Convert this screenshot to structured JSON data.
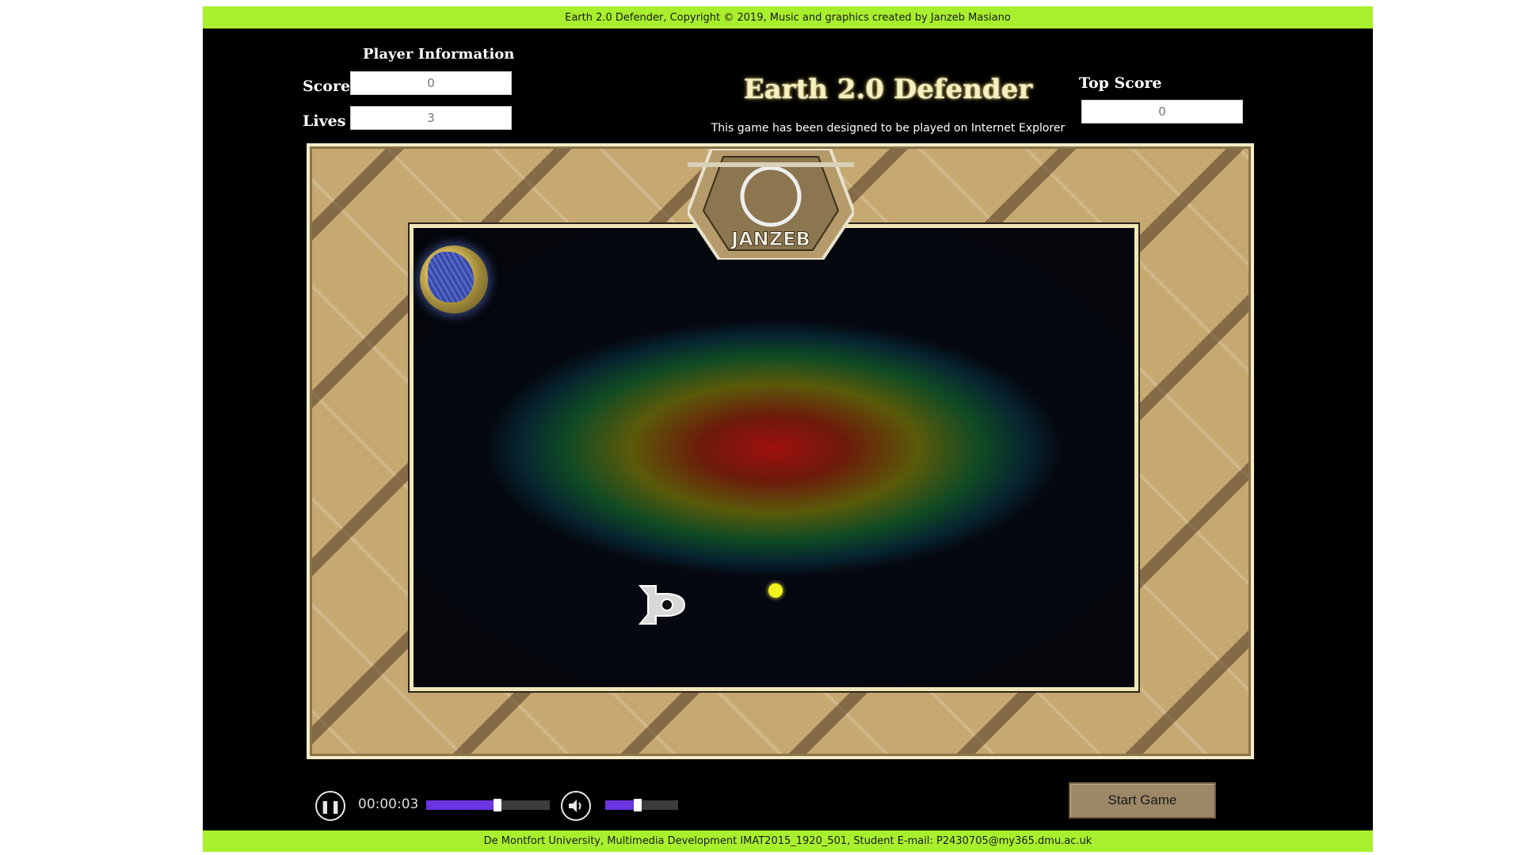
{
  "header": {
    "copyright": "Earth 2.0 Defender, Copyright © 2019, Music and graphics created by Janzeb Masiano"
  },
  "player_info": {
    "heading": "Player Information",
    "score_label": "Score",
    "score_value": "0",
    "lives_label": "Lives",
    "lives_value": "3"
  },
  "title": {
    "text": "Earth 2.0 Defender",
    "subtitle": "This game has been designed to be played on Internet Explorer"
  },
  "top_score": {
    "label": "Top Score",
    "value": "0"
  },
  "emblem": {
    "text": "JANZEB"
  },
  "controls": {
    "time": "00:00:03",
    "progress_fraction": 0.58,
    "volume_fraction": 0.45,
    "start_label": "Start Game",
    "pause_icon": "pause-icon",
    "volume_icon": "speaker-icon"
  },
  "footer": {
    "text": "De Montfort University, Multimedia Development IMAT2015_1920_501, Student E-mail: P2430705@my365.dmu.ac.uk"
  },
  "colors": {
    "accent_bar": "#a8f02d",
    "progress_fill": "#6a34e0",
    "projectile": "#f2f21c",
    "frame_sand": "#c6a871"
  }
}
